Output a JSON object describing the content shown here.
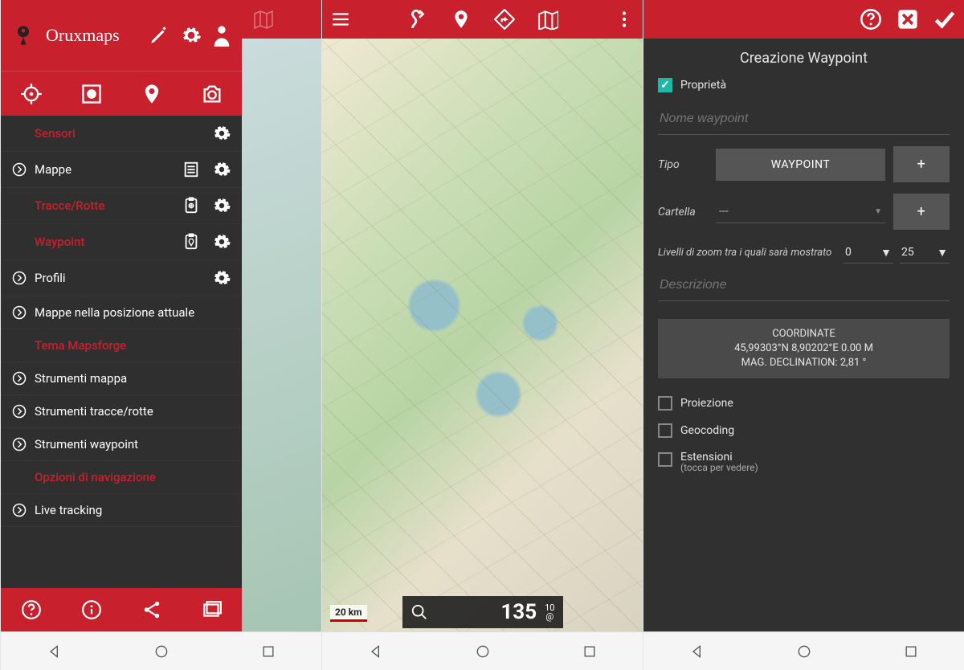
{
  "screen1": {
    "app_name": "Oruxmaps",
    "header_icons": [
      "edit-icon",
      "gear-icon",
      "user-icon"
    ],
    "toolbar_icons": [
      "target-icon",
      "record-icon",
      "pin-icon",
      "camera-icon"
    ],
    "menu": [
      {
        "label": "Sensori",
        "red": true,
        "chev": false,
        "icons": [
          "gear-icon"
        ]
      },
      {
        "label": "Mappe",
        "red": false,
        "chev": true,
        "icons": [
          "list-icon",
          "gear-icon"
        ]
      },
      {
        "label": "Tracce/Rotte",
        "red": true,
        "chev": false,
        "icons": [
          "clipboard-icon",
          "gear-icon"
        ]
      },
      {
        "label": "Waypoint",
        "red": true,
        "chev": false,
        "icons": [
          "clipboard-pin-icon",
          "gear-icon"
        ]
      },
      {
        "label": "Profili",
        "red": false,
        "chev": true,
        "icons": [
          "gear-icon"
        ]
      },
      {
        "label": "Mappe nella posizione attuale",
        "red": false,
        "chev": true,
        "icons": []
      },
      {
        "label": "Tema Mapsforge",
        "red": true,
        "chev": false,
        "icons": []
      },
      {
        "label": "Strumenti mappa",
        "red": false,
        "chev": true,
        "icons": []
      },
      {
        "label": "Strumenti tracce/rotte",
        "red": false,
        "chev": true,
        "icons": []
      },
      {
        "label": "Strumenti waypoint",
        "red": false,
        "chev": true,
        "icons": []
      },
      {
        "label": "Opzioni di navigazione",
        "red": true,
        "chev": false,
        "icons": []
      },
      {
        "label": "Live tracking",
        "red": false,
        "chev": true,
        "icons": []
      }
    ],
    "footer_icons": [
      "help-icon",
      "info-icon",
      "share-icon",
      "gallery-icon"
    ]
  },
  "screen2": {
    "topbar_icons_left": [
      "menu-icon"
    ],
    "topbar_icons_mid": [
      "route-icon",
      "pin-icon",
      "directions-icon",
      "map-icon"
    ],
    "topbar_icons_right": [
      "more-icon"
    ],
    "scale_label": "20 km",
    "zoom_value": "135",
    "zoom_sub_top": "10",
    "zoom_sub_bottom": "@"
  },
  "screen3": {
    "topbar_icons": [
      "help-icon",
      "close-icon",
      "confirm-icon"
    ],
    "title": "Creazione Waypoint",
    "properties_label": "Proprietà",
    "name_placeholder": "Nome waypoint",
    "type_label": "Tipo",
    "type_value": "WAYPOINT",
    "plus_label": "+",
    "folder_label": "Cartella",
    "folder_value": "---",
    "zoom_label": "Livelli di zoom tra i quali sarà mostrato",
    "zoom_min": "0",
    "zoom_max": "25",
    "description_placeholder": "Descrizione",
    "coord_title": "COORDINATE",
    "coord_value": "45,99303°N 8,90202°E 0.00 M",
    "coord_decl": "MAG. DECLINATION: 2,81 °",
    "checks": [
      {
        "label": "Proiezione"
      },
      {
        "label": "Geocoding"
      },
      {
        "label": "Estensioni",
        "sub": "(tocca per vedere)"
      }
    ]
  },
  "nav_icons": [
    "back-icon",
    "home-icon",
    "recent-icon"
  ]
}
